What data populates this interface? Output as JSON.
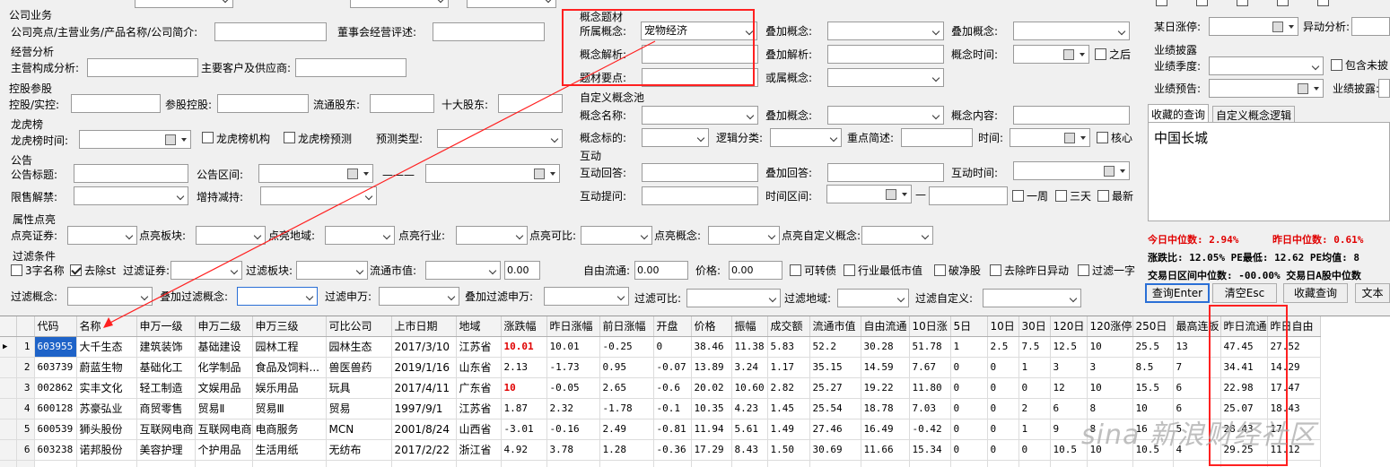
{
  "company": {
    "group": "公司业务",
    "highlight_label": "公司亮点/主营业务/产品名称/公司简介:",
    "board_label": "董事会经营评述:"
  },
  "operation": {
    "group": "经营分析",
    "main_label": "主营构成分析:",
    "customers_label": "主要客户及供应商:"
  },
  "holding": {
    "group": "控股参股",
    "holding_label": "控股/实控:",
    "participation_label": "参股控股:",
    "float_label": "流通股东:",
    "top10_label": "十大股东:"
  },
  "lhb": {
    "group": "龙虎榜",
    "time_label": "龙虎榜时间:",
    "institution_label": "龙虎榜机构",
    "forecast_label": "龙虎榜预测",
    "predict_type_label": "预测类型:"
  },
  "announce": {
    "group": "公告",
    "title_label": "公告标题:",
    "range_label": "公告区间:",
    "lift_label": "限售解禁:",
    "change_label": "增持减持:",
    "dash": "———"
  },
  "concept": {
    "group": "概念题材",
    "belong_label": "所属概念:",
    "belong_value": "宠物经济",
    "add1_label": "叠加概念:",
    "add2_label": "叠加概念:",
    "analysis_label": "概念解析:",
    "add_analysis_label": "叠加解析:",
    "time_label": "概念时间:",
    "after_label": "之后",
    "points_label": "题材要点:",
    "or_label": "或属概念:"
  },
  "custom": {
    "group": "自定义概念池",
    "name_label": "概念名称:",
    "add_label": "叠加概念:",
    "content_label": "概念内容:",
    "target_label": "概念标的:",
    "logic_label": "逻辑分类:",
    "key_label": "重点简述:",
    "time_label": "时间:",
    "core_label": "核心"
  },
  "interact": {
    "group": "互动",
    "answer_label": "互动回答:",
    "add_answer_label": "叠加回答:",
    "time_label": "互动时间:",
    "question_label": "互动提问:",
    "range_label": "时间区间:",
    "week_label": "一周",
    "three_label": "三天",
    "latest_label": "最新",
    "dash": "—"
  },
  "right": {
    "limit_label": "某日涨停:",
    "anomaly_label": "异动分析:",
    "perf_group": "业绩披露",
    "season_label": "业绩季度:",
    "include_label": "包含未披",
    "forecast_label": "业绩预告:",
    "disclose_label": "业绩披露:",
    "tab_fav": "收藏的查询",
    "tab_custom": "自定义概念逻辑",
    "fav_item": "中国长城",
    "median_today": "今日中位数: 2.94%",
    "median_yest": "昨日中位数: 0.61%",
    "stats1": "涨跌比: 12.05%  PE最低: 12.62  PE均值: 8",
    "stats2": "交易日区间中位数: -00.00%  交易日A股中位数",
    "btn_query": "查询Enter",
    "btn_clear": "清空Esc",
    "btn_fav": "收藏查询",
    "btn_text": "文本"
  },
  "highlight": {
    "group": "属性点亮",
    "sec": "点亮证券:",
    "board": "点亮板块:",
    "region": "点亮地域:",
    "industry": "点亮行业:",
    "compare": "点亮可比:",
    "concept": "点亮概念:",
    "custom": "点亮自定义概念:"
  },
  "filter": {
    "group": "过滤条件",
    "three": "3字名称",
    "st": "去除st",
    "sec": "过滤证券:",
    "board": "过滤板块:",
    "mv": "流通市值:",
    "mv_value": "0.00",
    "free": "自由流通:",
    "free_value": "0.00",
    "price": "价格:",
    "price_value": "0.00",
    "convertible": "可转债",
    "industry_min": "行业最低市值",
    "broken": "破净股",
    "yest_anomaly": "去除昨日异动",
    "one_line": "过滤一字",
    "concept": "过滤概念:",
    "add_concept": "叠加过滤概念:",
    "sw": "过滤申万:",
    "add_sw": "叠加过滤申万:",
    "compare": "过滤可比:",
    "region": "过滤地域:",
    "custom": "过滤自定义:"
  },
  "table": {
    "columns": [
      "代码",
      "名称",
      "申万一级",
      "申万二级",
      "申万三级",
      "可比公司",
      "上市日期",
      "地域",
      "涨跌幅",
      "昨日涨幅",
      "前日涨幅",
      "开盘",
      "价格",
      "振幅",
      "成交额",
      "流通市值",
      "自由流通",
      "10日涨",
      "5日",
      "10日",
      "30日",
      "120日",
      "120涨停",
      "250日",
      "最高连扳",
      "昨日流通",
      "昨日自由"
    ],
    "rows": [
      [
        "1",
        "603955",
        "大千生态",
        "建筑装饰",
        "基础建设",
        "园林工程",
        "园林生态",
        "2017/3/10",
        "江苏省",
        "10.01",
        "10.01",
        "-0.25",
        "0",
        "38.46",
        "11.38",
        "5.83",
        "52.2",
        "30.28",
        "51.78",
        "1",
        "2.5",
        "7.5",
        "12.5",
        "10",
        "25.5",
        "13",
        "47.45",
        "27.52"
      ],
      [
        "2",
        "603739",
        "蔚蓝生物",
        "基础化工",
        "化学制品",
        "食品及饲料...",
        "兽医兽药",
        "2019/1/16",
        "山东省",
        "2.13",
        "-1.73",
        "0.95",
        "-0.07",
        "13.89",
        "3.24",
        "1.17",
        "35.15",
        "14.59",
        "7.67",
        "0",
        "0",
        "1",
        "3",
        "3",
        "8.5",
        "7",
        "34.41",
        "14.29"
      ],
      [
        "3",
        "002862",
        "实丰文化",
        "轻工制造",
        "文娱用品",
        "娱乐用品",
        "玩具",
        "2017/4/11",
        "广东省",
        "10",
        "-0.05",
        "2.65",
        "-0.6",
        "20.02",
        "10.60",
        "2.82",
        "25.27",
        "19.22",
        "11.80",
        "0",
        "0",
        "0",
        "12",
        "10",
        "15.5",
        "6",
        "22.98",
        "17.47"
      ],
      [
        "4",
        "600128",
        "苏豪弘业",
        "商贸零售",
        "贸易Ⅱ",
        "贸易Ⅲ",
        "贸易",
        "1997/9/1",
        "江苏省",
        "1.87",
        "2.32",
        "-1.78",
        "-0.1",
        "10.35",
        "4.23",
        "1.45",
        "25.54",
        "18.78",
        "7.03",
        "0",
        "0",
        "2",
        "6",
        "8",
        "10",
        "6",
        "25.07",
        "18.43"
      ],
      [
        "5",
        "600539",
        "狮头股份",
        "互联网电商",
        "互联网电商",
        "电商服务",
        "MCN",
        "2001/8/24",
        "山西省",
        "-3.01",
        "-0.16",
        "2.49",
        "-0.81",
        "11.94",
        "5.61",
        "1.49",
        "27.46",
        "16.49",
        "-0.42",
        "0",
        "0",
        "1",
        "9",
        "8",
        "16",
        "5",
        "28.43",
        "17"
      ],
      [
        "6",
        "603238",
        "诺邦股份",
        "美容护理",
        "个护用品",
        "生活用纸",
        "无纺布",
        "2017/2/22",
        "浙江省",
        "4.92",
        "3.78",
        "1.28",
        "-0.36",
        "17.29",
        "8.43",
        "1.50",
        "30.69",
        "11.66",
        "15.34",
        "0",
        "0",
        "0",
        "10.5",
        "10",
        "10.5",
        "4",
        "29.25",
        "11.12"
      ]
    ]
  },
  "watermark": "sina 新浪财经社区"
}
